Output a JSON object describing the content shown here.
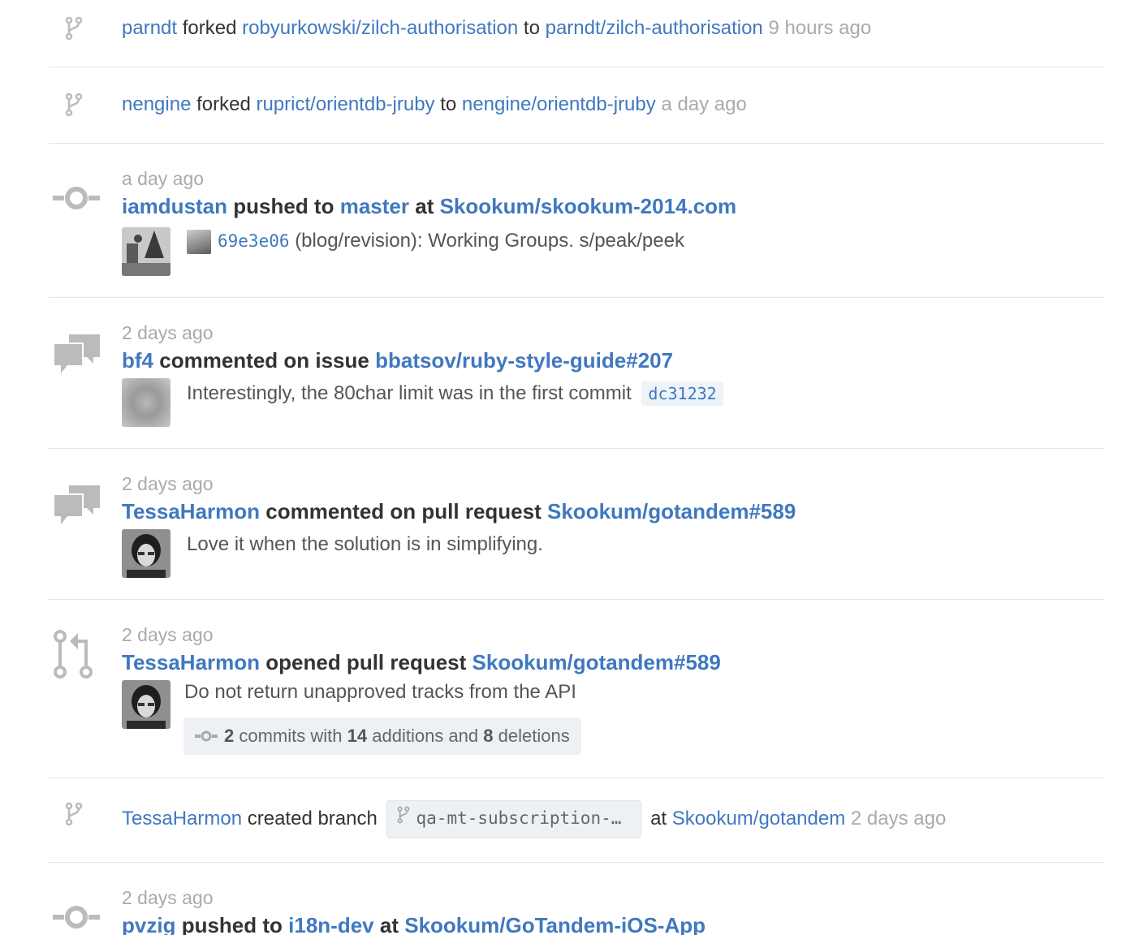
{
  "events": [
    {
      "type": "fork",
      "actor": "parndt",
      "verb": "forked",
      "source_repo": "robyurkowski/zilch-authorisation",
      "to_word": "to",
      "target_repo": "parndt/zilch-authorisation",
      "time": "9 hours ago"
    },
    {
      "type": "fork",
      "actor": "nengine",
      "verb": "forked",
      "source_repo": "ruprict/orientdb-jruby",
      "to_word": "to",
      "target_repo": "nengine/orientdb-jruby",
      "time": "a day ago"
    },
    {
      "type": "push",
      "time": "a day ago",
      "actor": "iamdustan",
      "verb": "pushed to",
      "branch": "master",
      "at_word": "at",
      "repo": "Skookum/skookum-2014.com",
      "commit_sha": "69e3e06",
      "commit_message": "(blog/revision): Working Groups. s/peak/peek"
    },
    {
      "type": "comment-issue",
      "time": "2 days ago",
      "actor": "bf4",
      "verb": "commented on issue",
      "target": "bbatsov/ruby-style-guide#207",
      "body": "Interestingly, the 80char limit was in the first commit",
      "sha": "dc31232"
    },
    {
      "type": "comment-pr",
      "time": "2 days ago",
      "actor": "TessaHarmon",
      "verb": "commented on pull request",
      "target": "Skookum/gotandem#589",
      "body": "Love it when the solution is in simplifying."
    },
    {
      "type": "open-pr",
      "time": "2 days ago",
      "actor": "TessaHarmon",
      "verb": "opened pull request",
      "target": "Skookum/gotandem#589",
      "body": "Do not return unapproved tracks from the API",
      "commits": "2",
      "commits_with": "commits with",
      "additions": "14",
      "additions_and": "additions and",
      "deletions": "8",
      "deletions_label": "deletions"
    },
    {
      "type": "branch",
      "actor": "TessaHarmon",
      "verb": "created branch",
      "branch": "qa-mt-subscription-…",
      "at_word": "at",
      "repo": "Skookum/gotandem",
      "time": "2 days ago"
    },
    {
      "type": "push",
      "time": "2 days ago",
      "actor": "pvzig",
      "verb": "pushed to",
      "branch": "i18n-dev",
      "at_word": "at",
      "repo": "Skookum/GoTandem-iOS-App"
    }
  ],
  "colors": {
    "link": "#4078c0",
    "muted": "#aaaaaa",
    "icon": "#bbbbbb",
    "divider": "#e5e5e5"
  }
}
